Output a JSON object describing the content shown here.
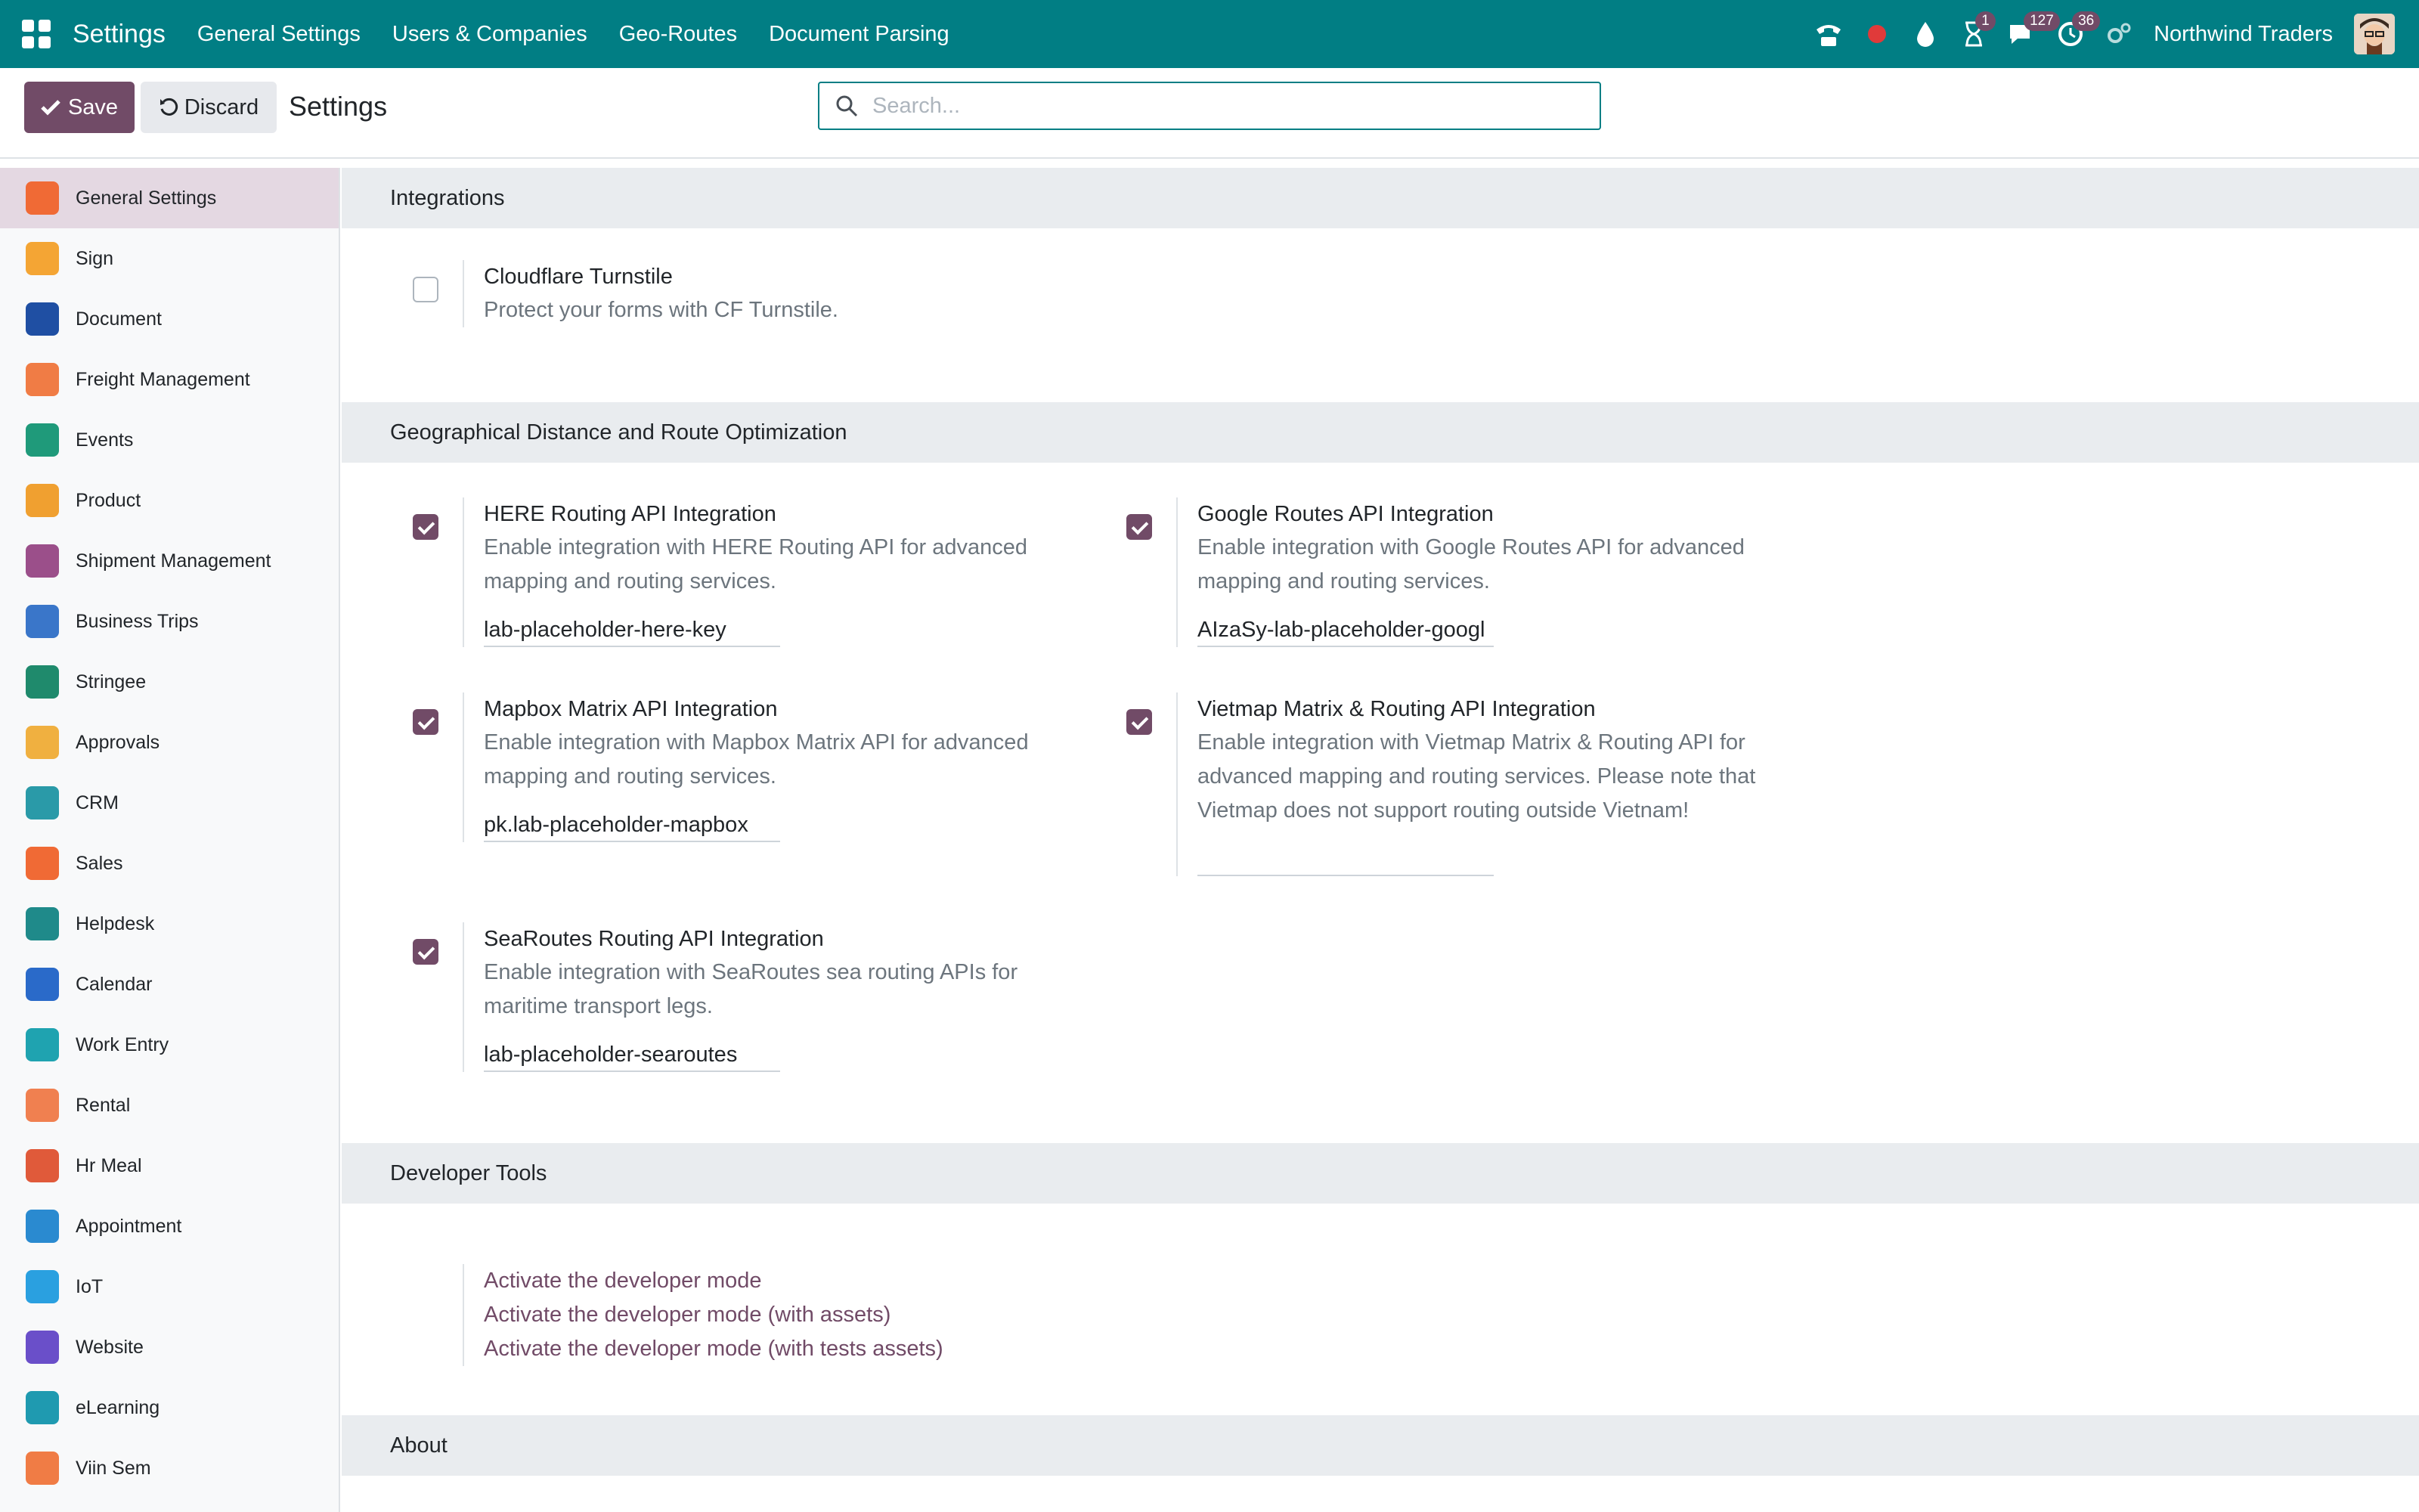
{
  "topbar": {
    "app_name": "Settings",
    "menu": [
      "General Settings",
      "Users & Companies",
      "Geo-Routes",
      "Document Parsing"
    ],
    "badges": {
      "activity": "1",
      "messages": "127",
      "timer": "36"
    },
    "company": "Northwind Traders"
  },
  "controlbar": {
    "save_label": "Save",
    "discard_label": "Discard",
    "breadcrumb": "Settings",
    "search_placeholder": "Search..."
  },
  "sidebar": {
    "items": [
      {
        "label": "General Settings",
        "icon": "general-settings-icon",
        "color": "#f06a35",
        "active": true
      },
      {
        "label": "Sign",
        "icon": "sign-icon",
        "color": "#f4a534"
      },
      {
        "label": "Document",
        "icon": "document-icon",
        "color": "#1f4fa3"
      },
      {
        "label": "Freight Management",
        "icon": "freight-icon",
        "color": "#f07c45"
      },
      {
        "label": "Events",
        "icon": "events-icon",
        "color": "#1f9a7a"
      },
      {
        "label": "Product",
        "icon": "product-icon",
        "color": "#f0a030"
      },
      {
        "label": "Shipment Management",
        "icon": "shipment-icon",
        "color": "#9b4f8a"
      },
      {
        "label": "Business Trips",
        "icon": "business-trips-icon",
        "color": "#3a76c9"
      },
      {
        "label": "Stringee",
        "icon": "stringee-icon",
        "color": "#1f8a6c"
      },
      {
        "label": "Approvals",
        "icon": "approvals-icon",
        "color": "#f0b040"
      },
      {
        "label": "CRM",
        "icon": "crm-icon",
        "color": "#2a9aa8"
      },
      {
        "label": "Sales",
        "icon": "sales-icon",
        "color": "#f06a35"
      },
      {
        "label": "Helpdesk",
        "icon": "helpdesk-icon",
        "color": "#1f8a8a"
      },
      {
        "label": "Calendar",
        "icon": "calendar-icon",
        "color": "#2a6ac9"
      },
      {
        "label": "Work Entry",
        "icon": "work-entry-icon",
        "color": "#1fa3b0"
      },
      {
        "label": "Rental",
        "icon": "rental-icon",
        "color": "#f08050"
      },
      {
        "label": "Hr Meal",
        "icon": "hr-meal-icon",
        "color": "#e05a3a"
      },
      {
        "label": "Appointment",
        "icon": "appointment-icon",
        "color": "#2a8ad0"
      },
      {
        "label": "IoT",
        "icon": "iot-icon",
        "color": "#2aa0e0"
      },
      {
        "label": "Website",
        "icon": "website-icon",
        "color": "#6a4fc9"
      },
      {
        "label": "eLearning",
        "icon": "elearning-icon",
        "color": "#1f9ab0"
      },
      {
        "label": "Viin Sem",
        "icon": "viin-sem-icon",
        "color": "#f07c45"
      }
    ]
  },
  "sections": {
    "integrations": "Integrations",
    "geo": "Geographical Distance and Route Optimization",
    "developer": "Developer Tools",
    "about": "About"
  },
  "settings": {
    "cloudflare": {
      "title": "Cloudflare Turnstile",
      "desc": "Protect your forms with CF Turnstile.",
      "checked": false
    },
    "here": {
      "title": "HERE Routing API Integration",
      "desc": "Enable integration with HERE Routing API for advanced mapping and routing services.",
      "value": "lab-placeholder-here-key",
      "checked": true
    },
    "google": {
      "title": "Google Routes API Integration",
      "desc": "Enable integration with Google Routes API for advanced mapping and routing services.",
      "value": "AIzaSy-lab-placeholder-googl",
      "checked": true
    },
    "mapbox": {
      "title": "Mapbox Matrix API Integration",
      "desc": "Enable integration with Mapbox Matrix API for advanced mapping and routing services.",
      "value": "pk.lab-placeholder-mapbox",
      "checked": true
    },
    "vietmap": {
      "title": "Vietmap Matrix & Routing API Integration",
      "desc": "Enable integration with Vietmap Matrix & Routing API for advanced mapping and routing services. Please note that Vietmap does not support routing outside Vietnam!",
      "value": "",
      "checked": true
    },
    "searoutes": {
      "title": "SeaRoutes Routing API Integration",
      "desc": "Enable integration with SeaRoutes sea routing APIs for maritime transport legs.",
      "value": "lab-placeholder-searoutes",
      "checked": true
    }
  },
  "developer_links": [
    "Activate the developer mode",
    "Activate the developer mode (with assets)",
    "Activate the developer mode (with tests assets)"
  ],
  "colors": {
    "brand": "#017e84",
    "primary": "#714b67"
  }
}
